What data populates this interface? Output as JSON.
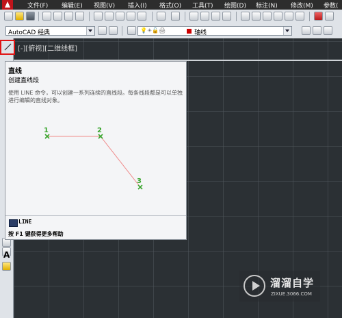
{
  "menubar": {
    "items": [
      "文件(F)",
      "编辑(E)",
      "视图(V)",
      "插入(I)",
      "格式(O)",
      "工具(T)",
      "绘图(D)",
      "标注(N)",
      "修改(M)",
      "参数("
    ]
  },
  "toolbar": {
    "workspace": "AutoCAD 经典",
    "layer": "轴线"
  },
  "viewport": {
    "label": "[-][俯视][二维线框]"
  },
  "tooltip": {
    "title": "直线",
    "subtitle": "创建直线段",
    "description": "使用 LINE 命令，可以创建一系列连续的直线段。每条线段都是可以单独进行编辑的直线对象。",
    "points": [
      "1",
      "2",
      "3"
    ],
    "command": "LINE",
    "help": "按 F1 键获得更多帮助"
  },
  "palette": {
    "text_tool": "A"
  },
  "watermark": {
    "text": "溜溜自学",
    "url": "ZIXUE.3066.COM"
  },
  "colors": {
    "canvas": "#2b3034",
    "line_color": "#ef8a8a",
    "point_color": "#3aa52e",
    "layer_color": "#cc0000",
    "accent": "#e01515"
  }
}
